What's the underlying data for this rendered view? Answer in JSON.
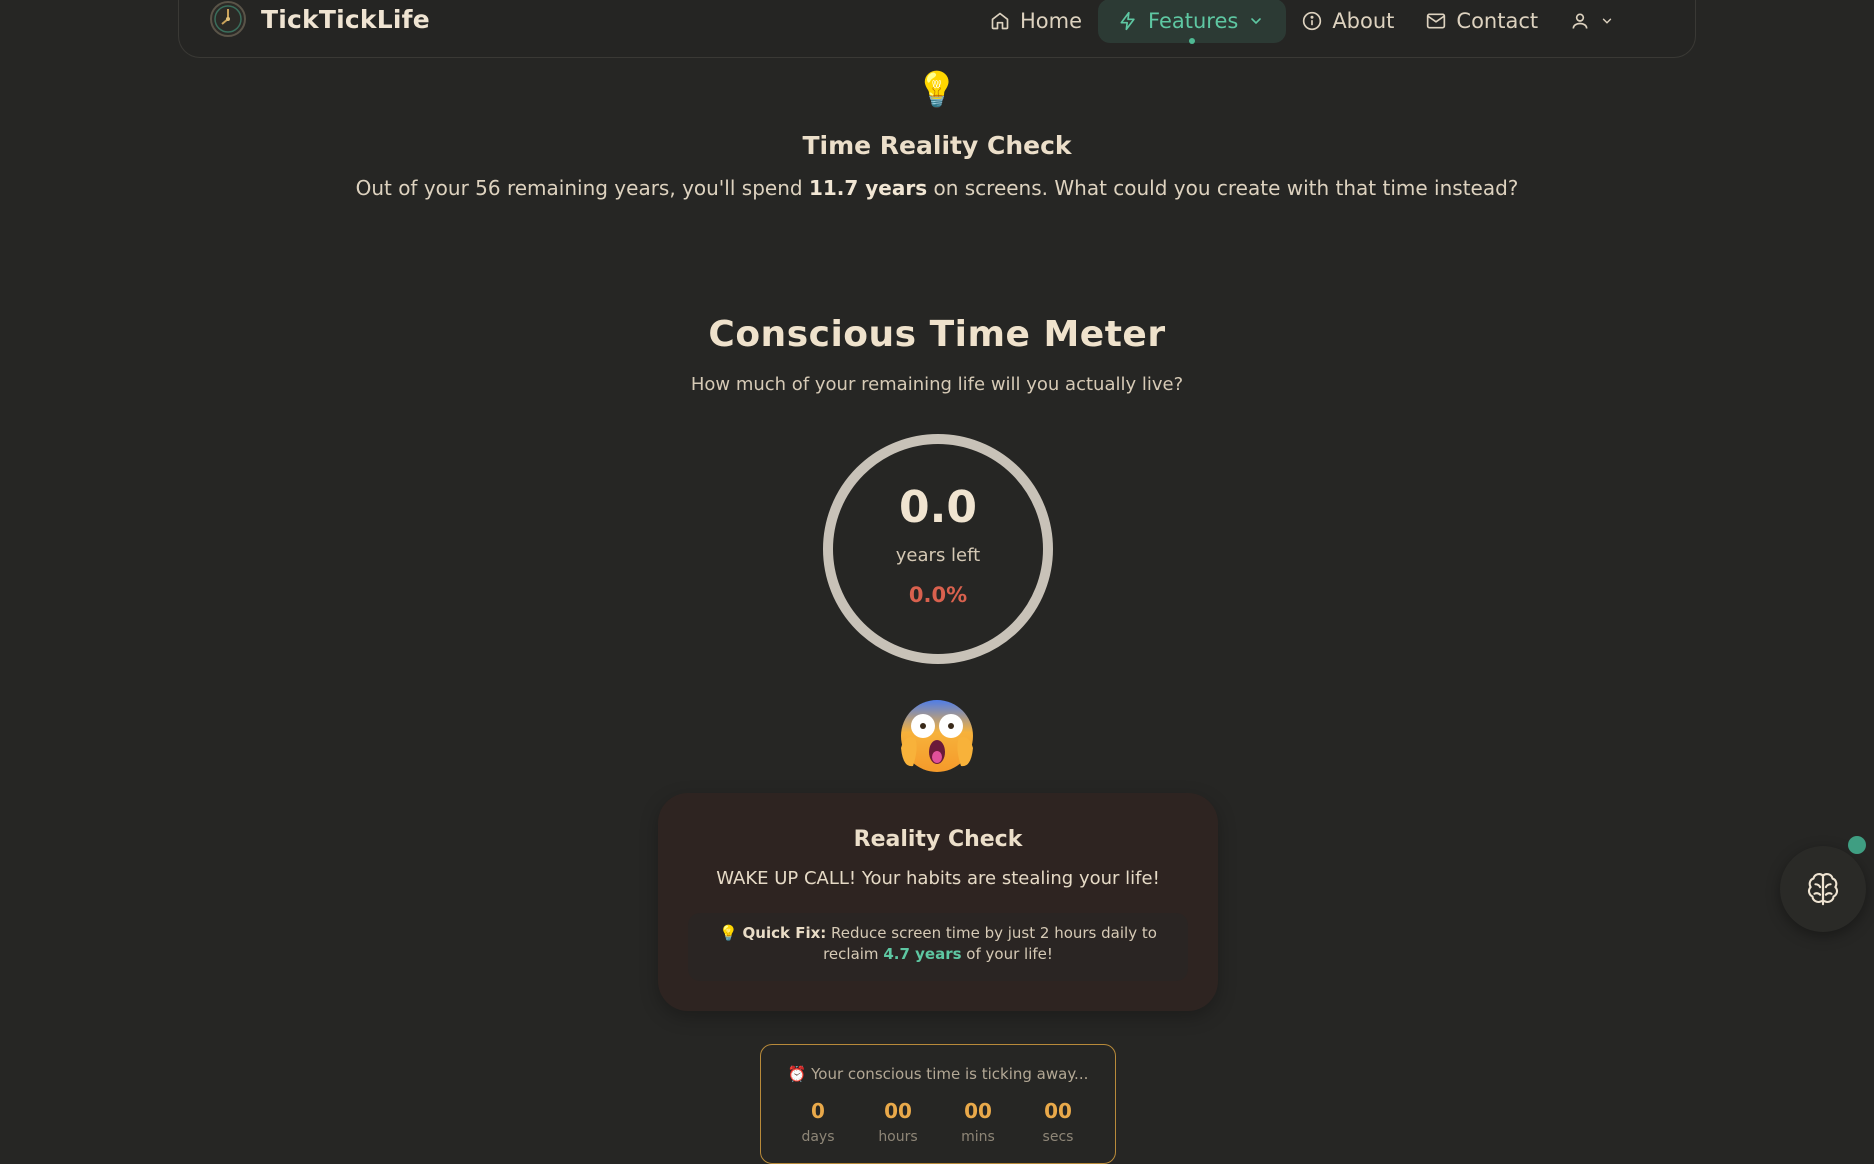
{
  "brand": {
    "name": "TickTickLife",
    "logo_icon": "clock-icon"
  },
  "nav": {
    "items": [
      {
        "label": "Home",
        "icon": "home-icon"
      },
      {
        "label": "Features",
        "icon": "lightning-icon",
        "active": true
      },
      {
        "label": "About",
        "icon": "info-icon"
      },
      {
        "label": "Contact",
        "icon": "mail-icon"
      }
    ],
    "user_icon": "user-icon"
  },
  "reality": {
    "icon": "lightbulb-icon",
    "title": "Time Reality Check",
    "text_before": "Out of your 56 remaining years, you'll spend ",
    "text_bold": "11.7 years",
    "text_after": " on screens. What could you create with that time instead?"
  },
  "meter": {
    "title": "Conscious Time Meter",
    "subtitle": "How much of your remaining life will you actually live?",
    "value": "0.0",
    "label": "years left",
    "percent": "0.0%",
    "fill_fraction": 0.0
  },
  "emoji": "screaming-face-icon",
  "card": {
    "title": "Reality Check",
    "text": "WAKE UP CALL! Your habits are stealing your life!",
    "tip_icon": "lightbulb-icon",
    "tip_label": "Quick Fix:",
    "tip_text": " Reduce screen time by just 2 hours daily to reclaim ",
    "tip_highlight": "4.7 years",
    "tip_tail": " of your life!"
  },
  "countdown": {
    "icon": "alarm-clock-icon",
    "heading": "Your conscious time is ticking away...",
    "cells": [
      {
        "value": "0",
        "unit": "days"
      },
      {
        "value": "00",
        "unit": "hours"
      },
      {
        "value": "00",
        "unit": "mins"
      },
      {
        "value": "00",
        "unit": "secs"
      }
    ]
  },
  "floating": {
    "icon": "brain-icon"
  },
  "colors": {
    "background": "#262624",
    "accent": "#5ec7a2",
    "danger": "#d9614e",
    "countdown_accent": "#e9a94a"
  }
}
